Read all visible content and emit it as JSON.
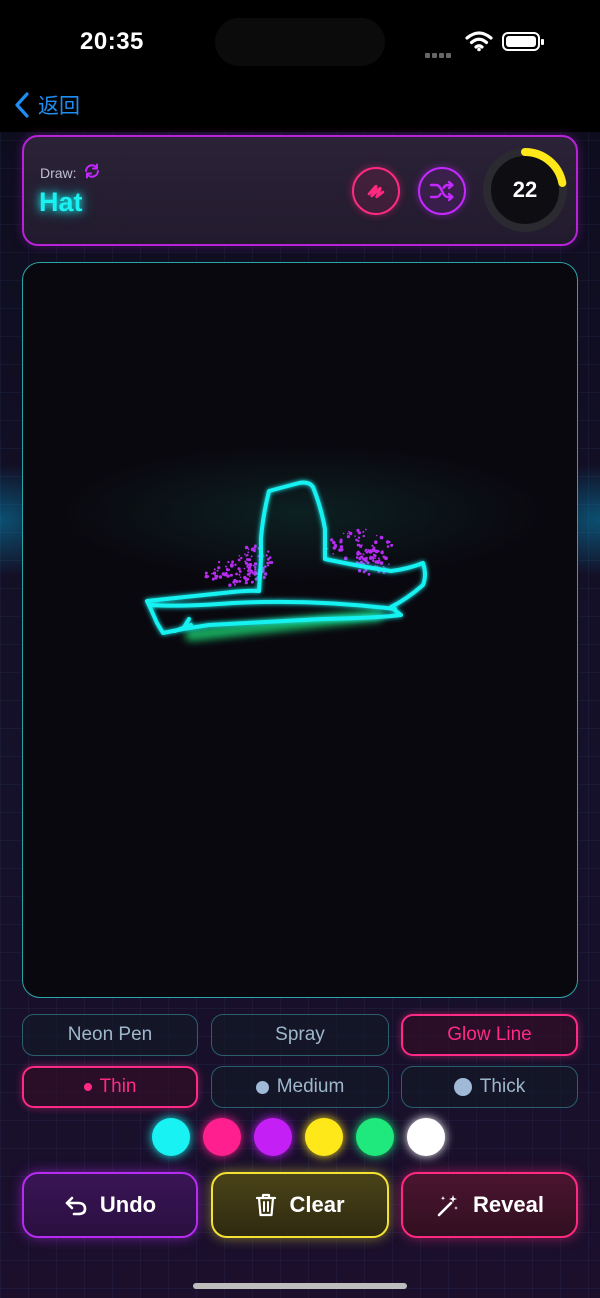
{
  "status_bar": {
    "time": "20:35"
  },
  "nav": {
    "back_label": "返回"
  },
  "prompt": {
    "draw_label": "Draw:",
    "word": "Hat"
  },
  "timer": {
    "value": "22",
    "remaining_fraction": 0.22
  },
  "tools": {
    "pen": "Neon Pen",
    "spray": "Spray",
    "glow": "Glow Line",
    "selected": "Glow Line"
  },
  "sizes": {
    "thin": "Thin",
    "medium": "Medium",
    "thick": "Thick",
    "selected": "Thin"
  },
  "colors": {
    "palette": [
      "#19f2f2",
      "#ff1f8e",
      "#c41ff5",
      "#ffe81a",
      "#1fe87c",
      "#ffffff"
    ],
    "selected_index": 5,
    "stroke_main": "#19f2f2",
    "stroke_spray": "#b62cf0",
    "stroke_glow": "#1fe87c"
  },
  "actions": {
    "undo": "Undo",
    "clear": "Clear",
    "reveal": "Reveal"
  }
}
